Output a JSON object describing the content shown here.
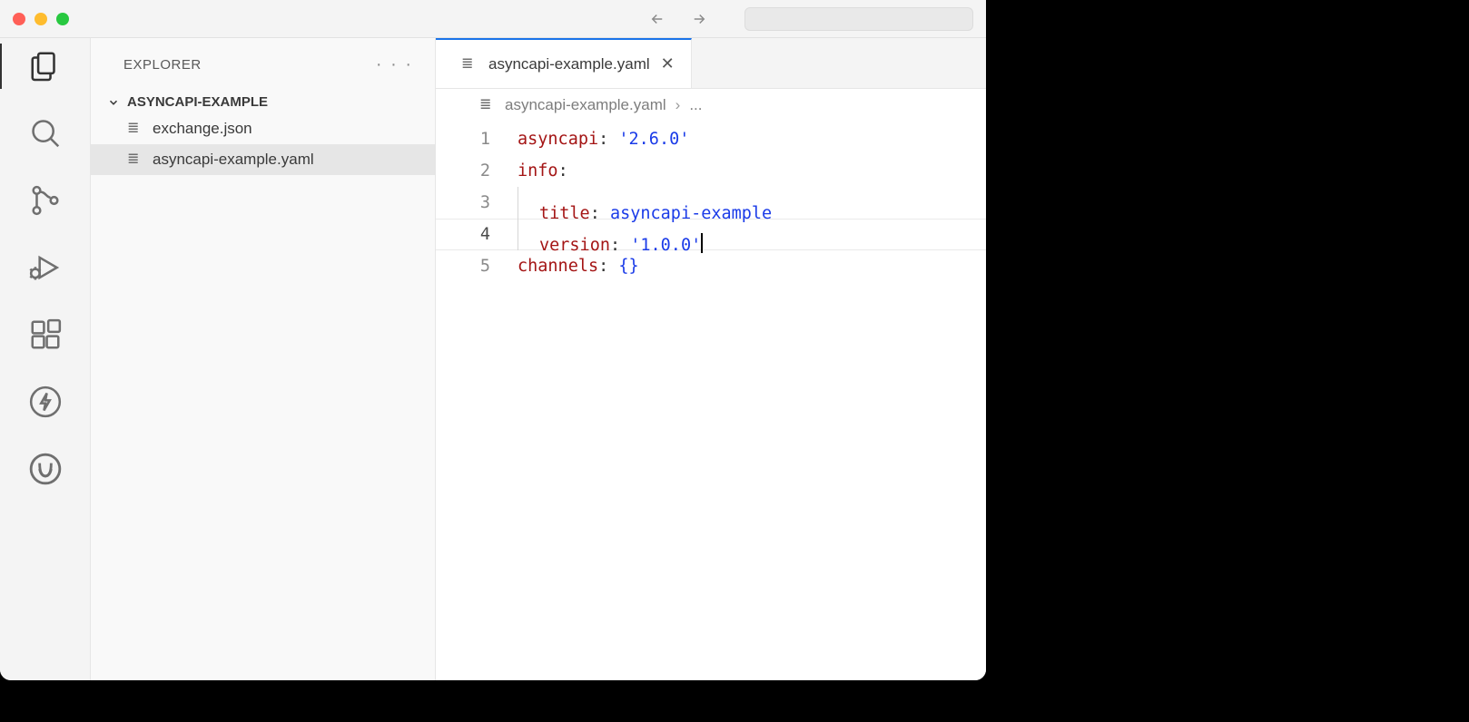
{
  "sidebar": {
    "title": "EXPLORER",
    "folder": "ASYNCAPI-EXAMPLE",
    "files": [
      {
        "name": "exchange.json"
      },
      {
        "name": "asyncapi-example.yaml"
      }
    ]
  },
  "tab": {
    "label": "asyncapi-example.yaml"
  },
  "breadcrumb": {
    "file": "asyncapi-example.yaml",
    "more": "..."
  },
  "editor": {
    "lines": {
      "l1": {
        "num": "1"
      },
      "l2": {
        "num": "2"
      },
      "l3": {
        "num": "3"
      },
      "l4": {
        "num": "4"
      },
      "l5": {
        "num": "5"
      }
    },
    "tokens": {
      "asyncapi_key": "asyncapi",
      "asyncapi_val": "'2.6.0'",
      "info_key": "info",
      "title_key": "title",
      "title_val": "asyncapi-example",
      "version_key": "version",
      "version_val": "'1.0.0'",
      "channels_key": "channels",
      "channels_val": "{}",
      "colon": ":",
      "colon_sp": ": "
    }
  }
}
